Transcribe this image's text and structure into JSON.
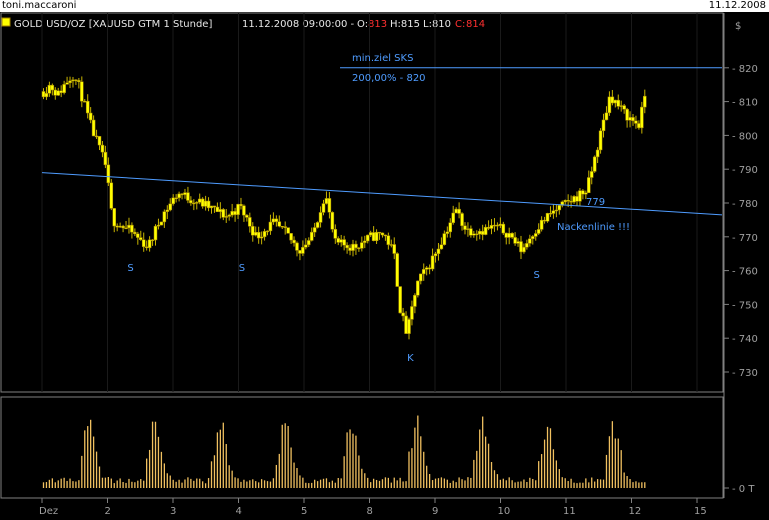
{
  "window": {
    "user": "toni.maccaroni",
    "date": "11.12.2008"
  },
  "header": {
    "symbol": "GOLD USD/OZ [XAUUSD GTM  1 Stunde]",
    "timestamp": "11.12.2008 09:00:00 -",
    "o_label": "O:",
    "o_value": "813",
    "h_text": "H:815",
    "l_text": "L:810",
    "c_label": "C:",
    "c_value": "814"
  },
  "colors": {
    "background": "#000000",
    "candle_up": "#ffff00",
    "candle_wick": "#c8b400",
    "annotation": "#4f9cff",
    "volume_bar": "#f0c060",
    "axis_text": "#a0a0a0",
    "open_value": "#ff3030"
  },
  "chart_data": {
    "type": "candlestick",
    "price_axis": {
      "ylim": [
        727,
        825
      ],
      "ticks": [
        730,
        740,
        750,
        760,
        770,
        780,
        790,
        800,
        810,
        820
      ],
      "currency_mark": "$"
    },
    "x_axis": {
      "ticks": [
        "Dez",
        "2",
        "3",
        "4",
        "5",
        "8",
        "9",
        "10",
        "11",
        "12",
        "15"
      ]
    },
    "close_path": [
      {
        "x": 0.0,
        "p": 813
      },
      {
        "x": 0.1,
        "p": 815
      },
      {
        "x": 0.22,
        "p": 812
      },
      {
        "x": 0.35,
        "p": 816
      },
      {
        "x": 0.45,
        "p": 818
      },
      {
        "x": 0.55,
        "p": 814
      },
      {
        "x": 0.7,
        "p": 804
      },
      {
        "x": 0.95,
        "p": 791
      },
      {
        "x": 1.05,
        "p": 775
      },
      {
        "x": 1.3,
        "p": 772
      },
      {
        "x": 1.6,
        "p": 767
      },
      {
        "x": 1.8,
        "p": 776
      },
      {
        "x": 2.05,
        "p": 783
      },
      {
        "x": 2.4,
        "p": 780
      },
      {
        "x": 2.8,
        "p": 776
      },
      {
        "x": 3.0,
        "p": 779
      },
      {
        "x": 3.25,
        "p": 770
      },
      {
        "x": 3.5,
        "p": 774
      },
      {
        "x": 3.7,
        "p": 771
      },
      {
        "x": 3.9,
        "p": 766
      },
      {
        "x": 4.1,
        "p": 770
      },
      {
        "x": 4.3,
        "p": 783
      },
      {
        "x": 4.45,
        "p": 768
      },
      {
        "x": 4.75,
        "p": 767
      },
      {
        "x": 5.0,
        "p": 770
      },
      {
        "x": 5.2,
        "p": 771
      },
      {
        "x": 5.35,
        "p": 765
      },
      {
        "x": 5.45,
        "p": 748
      },
      {
        "x": 5.55,
        "p": 741
      },
      {
        "x": 5.7,
        "p": 756
      },
      {
        "x": 5.9,
        "p": 762
      },
      {
        "x": 6.1,
        "p": 770
      },
      {
        "x": 6.3,
        "p": 778
      },
      {
        "x": 6.45,
        "p": 772
      },
      {
        "x": 6.7,
        "p": 772
      },
      {
        "x": 6.9,
        "p": 773
      },
      {
        "x": 7.1,
        "p": 771
      },
      {
        "x": 7.3,
        "p": 766
      },
      {
        "x": 7.5,
        "p": 772
      },
      {
        "x": 7.75,
        "p": 777
      },
      {
        "x": 8.0,
        "p": 780
      },
      {
        "x": 8.3,
        "p": 784
      },
      {
        "x": 8.5,
        "p": 800
      },
      {
        "x": 8.65,
        "p": 812
      },
      {
        "x": 8.8,
        "p": 808
      },
      {
        "x": 8.95,
        "p": 805
      },
      {
        "x": 9.1,
        "p": 803
      },
      {
        "x": 9.2,
        "p": 814
      }
    ],
    "volume": {
      "scale_max": 100,
      "ticks": [
        {
          "label": "0 T",
          "value": 0
        }
      ],
      "session_peaks": [
        0.65,
        1.65,
        2.65,
        3.65,
        4.65,
        5.65,
        6.65,
        7.65,
        8.65
      ]
    },
    "annotations": {
      "target_label": "min.ziel SKS",
      "target_level_label": "200,00% - 820",
      "target_price": 820,
      "neckline_label": "Nackenlinie !!!",
      "neckline_value": "779",
      "neckline": {
        "from": {
          "x": 0.0,
          "p": 789
        },
        "to": {
          "x": 10.5,
          "p": 776.5
        }
      },
      "shoulder_markers": [
        {
          "label": "S",
          "x": 1.35,
          "p": 761
        },
        {
          "label": "S",
          "x": 3.05,
          "p": 761
        },
        {
          "label": "K",
          "x": 5.62,
          "p": 734.5
        },
        {
          "label": "S",
          "x": 7.55,
          "p": 759
        }
      ]
    }
  }
}
